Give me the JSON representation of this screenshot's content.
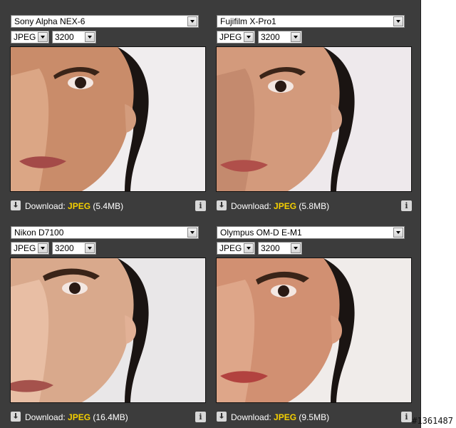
{
  "cells": [
    {
      "camera": "Sony Alpha NEX-6",
      "format": "JPEG",
      "iso": "3200",
      "download_label": "Download:",
      "file_format": "JPEG",
      "file_size": "(5.4MB)"
    },
    {
      "camera": "Fujifilm X-Pro1",
      "format": "JPEG",
      "iso": "3200",
      "download_label": "Download:",
      "file_format": "JPEG",
      "file_size": "(5.8MB)"
    },
    {
      "camera": "Nikon D7100",
      "format": "JPEG",
      "iso": "3200",
      "download_label": "Download:",
      "file_format": "JPEG",
      "file_size": "(16.4MB)"
    },
    {
      "camera": "Olympus OM-D E-M1",
      "format": "JPEG",
      "iso": "3200",
      "download_label": "Download:",
      "file_format": "JPEG",
      "file_size": "(9.5MB)"
    }
  ],
  "info_glyph": "i",
  "watermark": "#1361487",
  "colors": {
    "panel": "#3c3c3c",
    "accent_format": "#f5d000"
  }
}
